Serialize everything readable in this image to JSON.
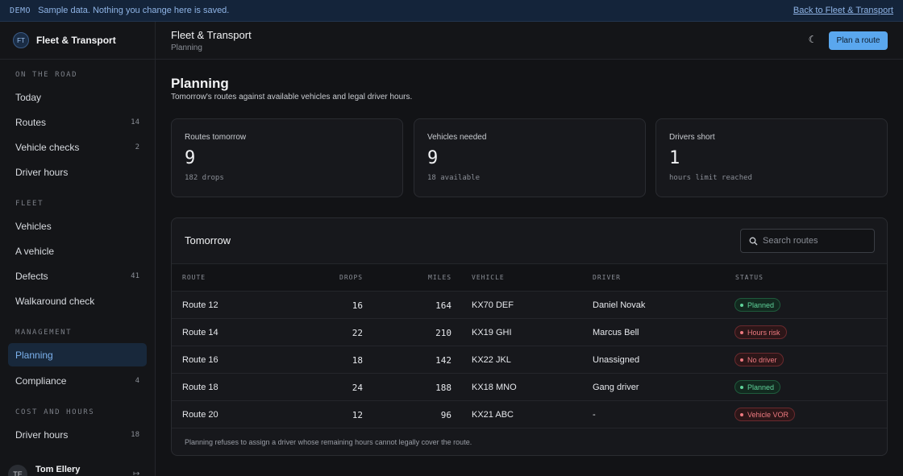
{
  "banner": {
    "tag": "DEMO",
    "message": "Sample data. Nothing you change here is saved.",
    "link": "Back to Fleet & Transport"
  },
  "brand": {
    "initials": "FT",
    "name": "Fleet & Transport"
  },
  "sidebar": {
    "sections": [
      {
        "label": "ON THE ROAD",
        "items": [
          {
            "label": "Today",
            "count": ""
          },
          {
            "label": "Routes",
            "count": "14"
          },
          {
            "label": "Vehicle checks",
            "count": "2"
          },
          {
            "label": "Driver hours",
            "count": ""
          }
        ]
      },
      {
        "label": "FLEET",
        "items": [
          {
            "label": "Vehicles",
            "count": ""
          },
          {
            "label": "A vehicle",
            "count": ""
          },
          {
            "label": "Defects",
            "count": "41"
          },
          {
            "label": "Walkaround check",
            "count": ""
          }
        ]
      },
      {
        "label": "MANAGEMENT",
        "items": [
          {
            "label": "Planning",
            "count": "",
            "active": true
          },
          {
            "label": "Compliance",
            "count": "4"
          }
        ]
      },
      {
        "label": "COST AND HOURS",
        "items": [
          {
            "label": "Driver hours",
            "count": "18"
          }
        ]
      }
    ],
    "user": {
      "initials": "TE",
      "name": "Tom Ellery"
    }
  },
  "topbar": {
    "title": "Fleet & Transport",
    "subtitle": "Planning",
    "theme_icon": "moon-icon",
    "cta": "Plan a route"
  },
  "page": {
    "heading": "Planning",
    "lede": "Tomorrow's routes against available vehicles and legal driver hours."
  },
  "stats": [
    {
      "label": "Routes tomorrow",
      "value": "9",
      "note": "182 drops"
    },
    {
      "label": "Vehicles needed",
      "value": "9",
      "note": "18 available"
    },
    {
      "label": "Drivers short",
      "value": "1",
      "note": "hours limit reached"
    }
  ],
  "table": {
    "title": "Tomorrow",
    "search_placeholder": "Search routes",
    "columns": {
      "route": "ROUTE",
      "drops": "DROPS",
      "miles": "MILES",
      "vehicle": "VEHICLE",
      "driver": "DRIVER",
      "status": "STATUS"
    },
    "rows": [
      {
        "route": "Route 12",
        "drops": "16",
        "miles": "164",
        "vehicle": "KX70 DEF",
        "driver": "Daniel Novak",
        "status": "Planned",
        "tone": "green"
      },
      {
        "route": "Route 14",
        "drops": "22",
        "miles": "210",
        "vehicle": "KX19 GHI",
        "driver": "Marcus Bell",
        "status": "Hours risk",
        "tone": "red"
      },
      {
        "route": "Route 16",
        "drops": "18",
        "miles": "142",
        "vehicle": "KX22 JKL",
        "driver": "Unassigned",
        "status": "No driver",
        "tone": "red"
      },
      {
        "route": "Route 18",
        "drops": "24",
        "miles": "188",
        "vehicle": "KX18 MNO",
        "driver": "Gang driver",
        "status": "Planned",
        "tone": "green"
      },
      {
        "route": "Route 20",
        "drops": "12",
        "miles": "96",
        "vehicle": "KX21 ABC",
        "driver": "-",
        "status": "Vehicle VOR",
        "tone": "red"
      }
    ],
    "footnote": "Planning refuses to assign a driver whose remaining hours cannot legally cover the route."
  },
  "colors": {
    "accent": "#5aa7ee",
    "planned": "#5fd39a",
    "risk": "#ee7a80",
    "background": "#121316"
  }
}
